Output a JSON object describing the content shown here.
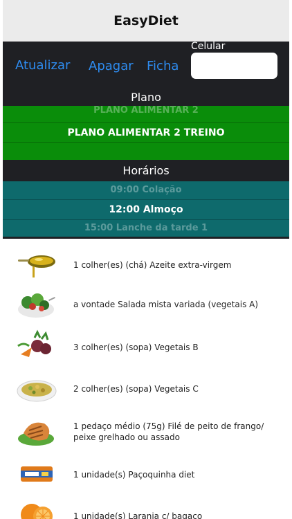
{
  "app": {
    "title": "EasyDiet"
  },
  "toolbar": {
    "atualizar_label": "Atualizar",
    "apagar_label": "Apagar",
    "ficha_label": "Ficha",
    "celular_label": "Celular",
    "celular_value": ""
  },
  "plano": {
    "label": "Plano",
    "options_above": [
      "PLANO ALIMENTAR 2"
    ],
    "selected": "PLANO ALIMENTAR 2 TREINO"
  },
  "horarios": {
    "label": "Horários",
    "options_above": [
      "09:00 Colação"
    ],
    "selected": "12:00 Almoço",
    "options_below": [
      "15:00 Lanche da tarde 1"
    ]
  },
  "items": [
    {
      "text": "1 colher(es) (chá) Azeite extra-virgem",
      "icon": "olive-oil-spoon-icon"
    },
    {
      "text": " a vontade Salada mista variada (vegetais A)",
      "icon": "salad-icon"
    },
    {
      "text": "3 colher(es) (sopa) Vegetais B",
      "icon": "vegetables-icon"
    },
    {
      "text": "2 colher(es) (sopa) Vegetais C",
      "icon": "cooked-vegetables-icon"
    },
    {
      "text": "1 pedaço médio (75g) Filé de peito de frango/ peixe grelhado ou assado",
      "icon": "grilled-chicken-icon"
    },
    {
      "text": "1 unidade(s) Paçoquinha diet",
      "icon": "pacoquinha-icon"
    },
    {
      "text": "1 unidade(s) Laranja c/ bagaço",
      "icon": "orange-icon"
    }
  ],
  "colors": {
    "navbar": "#ebebeb",
    "dark_panel": "#1f2024",
    "accent_blue": "#2e8cf0",
    "plano_picker": "#0a8d0a",
    "horarios_picker": "#0e6a6c"
  }
}
